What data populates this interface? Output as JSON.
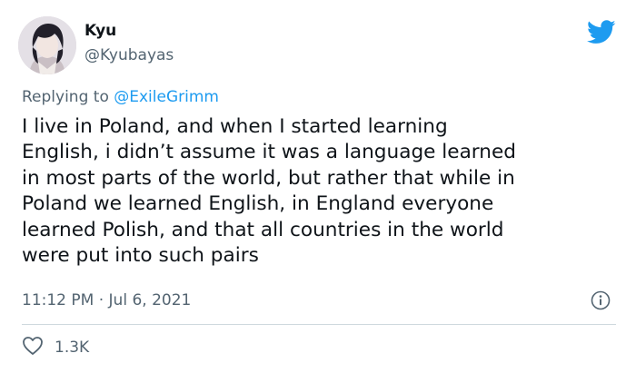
{
  "author": {
    "display_name": "Kyu",
    "handle": "@Kyubayas"
  },
  "reply": {
    "prefix": "Replying to ",
    "user": "@ExileGrimm"
  },
  "tweet": {
    "text": "I live in Poland, and when I started learning\nEnglish, i didn’t assume it was a language learned\nin most parts of the world, but rather that while in\nPoland we learned English, in England everyone\nlearned Polish, and that all countries in the world\nwere put into such pairs",
    "timestamp": "11:12 PM · Jul 6, 2021"
  },
  "engagement": {
    "likes": "1.3K"
  },
  "icons": {
    "brand": "twitter-bird-icon",
    "info": "info-icon",
    "like": "heart-icon"
  },
  "colors": {
    "brand_blue": "#1d9bf0",
    "secondary_text": "#536471",
    "primary_text": "#0f1419",
    "divider": "#cfd9de"
  }
}
